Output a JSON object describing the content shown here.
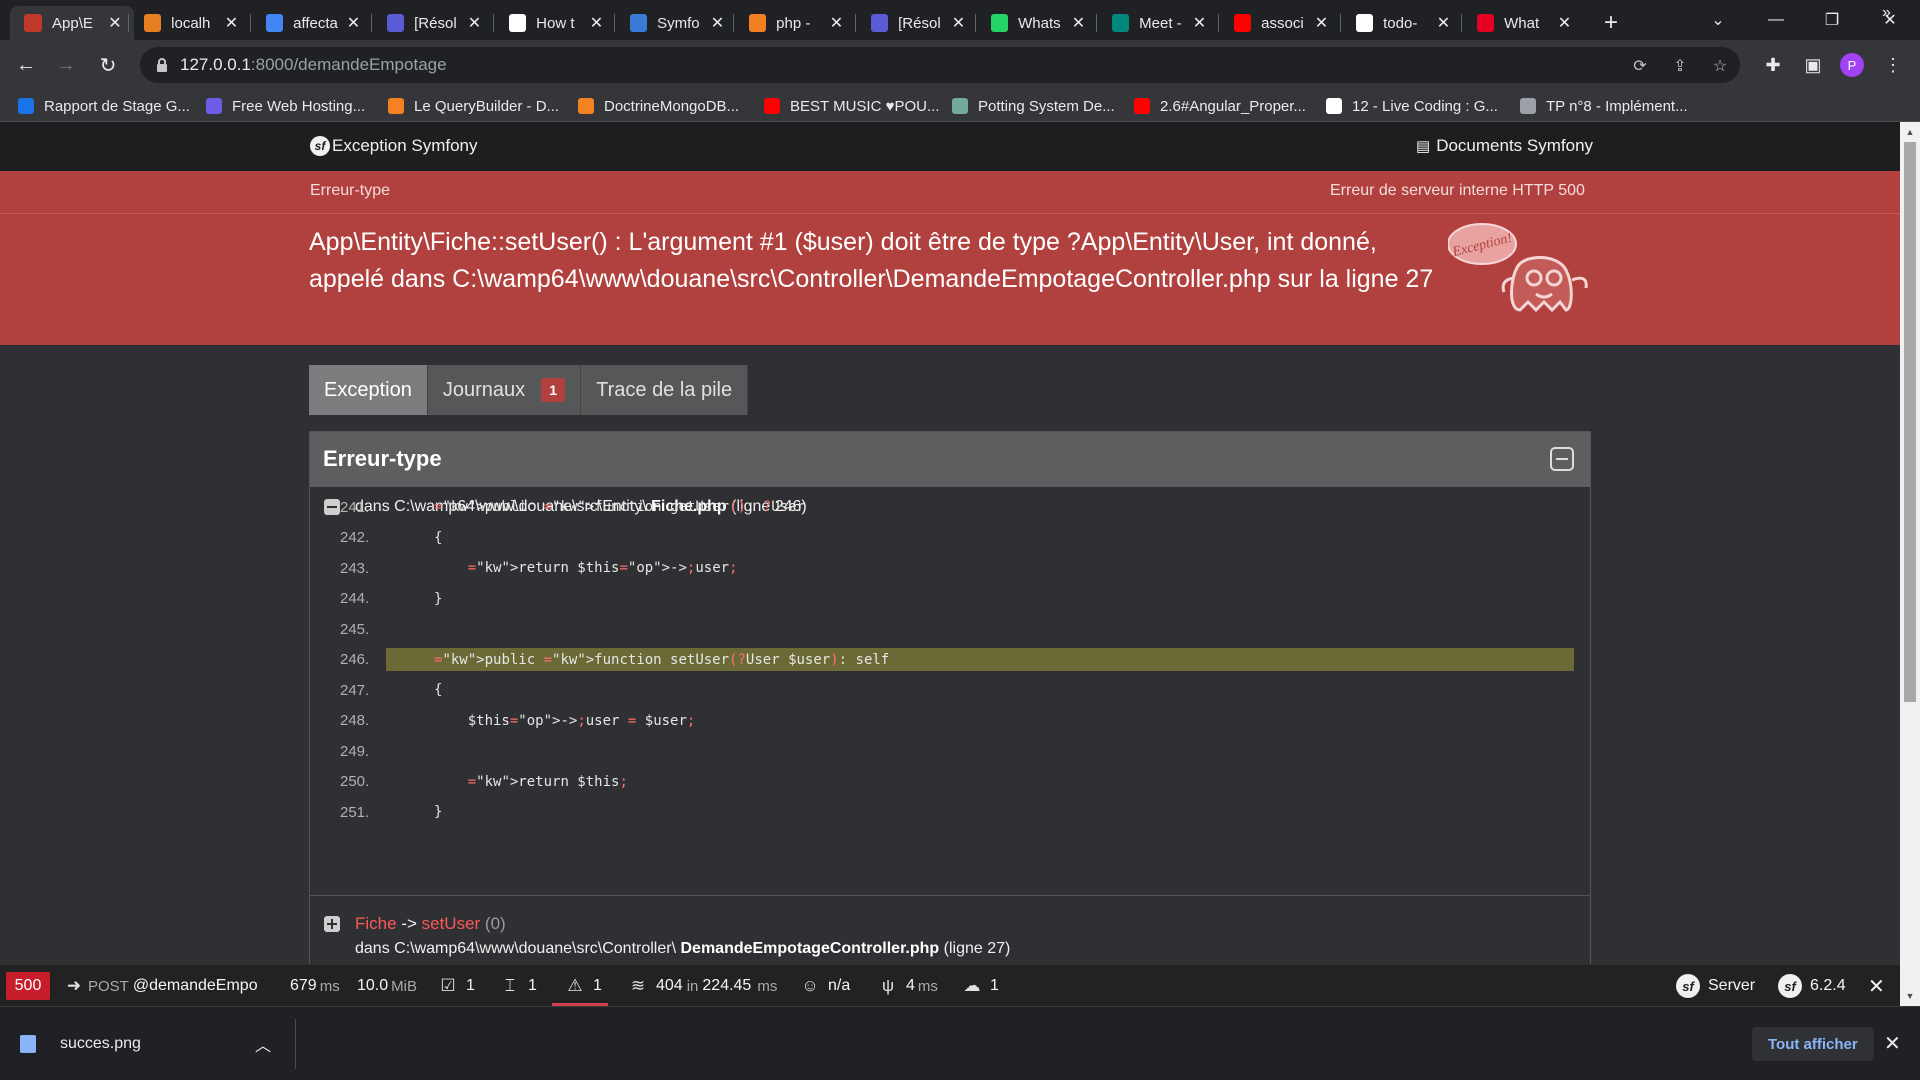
{
  "browser": {
    "tabs": [
      {
        "label": "App\\E",
        "icon": "symfony-ghost-icon",
        "color": "#c0392b"
      },
      {
        "label": "localh",
        "icon": "wamp-icon",
        "color": "#e67e22"
      },
      {
        "label": "affecta",
        "icon": "google-icon",
        "color": "#4285f4"
      },
      {
        "label": "[Résol",
        "icon": "d-icon",
        "color": "#5b5bd6"
      },
      {
        "label": "How t",
        "icon": "symfony-icon",
        "color": "#ffffff"
      },
      {
        "label": "Symfo",
        "icon": "symfonycasts-icon",
        "color": "#3a7bd5"
      },
      {
        "label": "php - ",
        "icon": "stackoverflow-icon",
        "color": "#f48024"
      },
      {
        "label": "[Résol",
        "icon": "d-icon",
        "color": "#5b5bd6"
      },
      {
        "label": "Whats",
        "icon": "whatsapp-icon",
        "color": "#25d366"
      },
      {
        "label": "Meet -",
        "icon": "meet-icon",
        "color": "#00897b"
      },
      {
        "label": "associ",
        "icon": "youtube-icon",
        "color": "#ff0000"
      },
      {
        "label": "todo-",
        "icon": "github-icon",
        "color": "#ffffff"
      },
      {
        "label": "What ",
        "icon": "pinterest-icon",
        "color": "#e60023"
      }
    ],
    "url_host": "127.0.0.1",
    "url_path": ":8000/demandeEmpotage",
    "profile_initial": "P",
    "bookmarks": [
      {
        "label": "Rapport de Stage G...",
        "icon": "s-icon",
        "color": "#1a73e8"
      },
      {
        "label": "Free Web Hosting...",
        "icon": "infinity-icon",
        "color": "#6c5ce7"
      },
      {
        "label": "Le QueryBuilder - D...",
        "icon": "doctrine-icon",
        "color": "#f58220"
      },
      {
        "label": "DoctrineMongoDB...",
        "icon": "doctrine-icon",
        "color": "#f58220"
      },
      {
        "label": "BEST MUSIC ♥POU...",
        "icon": "youtube-icon",
        "color": "#ff0000"
      },
      {
        "label": "Potting System De...",
        "icon": "openai-icon",
        "color": "#74aa9c"
      },
      {
        "label": "2.6#Angular_Proper...",
        "icon": "youtube-icon",
        "color": "#ff0000"
      },
      {
        "label": "12 - Live Coding : G...",
        "icon": "codingame-icon",
        "color": "#ffffff"
      },
      {
        "label": "TP n°8 - Implément...",
        "icon": "globe-icon",
        "color": "#9aa0a6"
      }
    ]
  },
  "symfony": {
    "header_left": "Exception Symfony",
    "header_right": "Documents Symfony",
    "error_type": "Erreur-type",
    "http_status": "Erreur de serveur interne HTTP 500",
    "message": "App\\Entity\\Fiche::setUser() : L'argument #1 ($user) doit être de type ?App\\Entity\\User, int donné, appelé dans C:\\wamp64\\www\\douane\\src\\Controller\\DemandeEmpotageController.php sur la ligne 27",
    "ghost_label": "Exception!",
    "tabs": [
      {
        "label": "Exception",
        "active": true
      },
      {
        "label": "Journaux",
        "badge": "1"
      },
      {
        "label": "Trace de la pile"
      }
    ],
    "panel_title": "Erreur-type",
    "trace1": {
      "prefix": "dans C:\\wamp64\\www\\douane\\src\\Entity\\ ",
      "file": "Fiche.php",
      "suffix": " (ligne 246)"
    },
    "code_lines": [
      {
        "n": "241.",
        "code": "public function getUser(): ?User"
      },
      {
        "n": "242.",
        "code": "{"
      },
      {
        "n": "243.",
        "code": "    return $this->user;"
      },
      {
        "n": "244.",
        "code": "}"
      },
      {
        "n": "245.",
        "code": ""
      },
      {
        "n": "246.",
        "code": "public function setUser(?User $user): self"
      },
      {
        "n": "247.",
        "code": "{"
      },
      {
        "n": "248.",
        "code": "    $this->user = $user;"
      },
      {
        "n": "249.",
        "code": ""
      },
      {
        "n": "250.",
        "code": "    return $this;"
      },
      {
        "n": "251.",
        "code": "}"
      }
    ],
    "highlight_line": "246.",
    "trace2": {
      "class": "Fiche",
      "arrow": " -> ",
      "method": "setUser",
      "args": " (0)",
      "prefix": "dans C:\\wamp64\\www\\douane\\src\\Controller\\ ",
      "file": "DemandeEmpotageController.php",
      "suffix": " (ligne 27)"
    }
  },
  "profiler": {
    "status": "500",
    "method": "POST",
    "route": "@demandeEmpotag",
    "time": "679",
    "time_unit": "ms",
    "memory": "10.0",
    "memory_unit": "MiB",
    "forms": "1",
    "validator": "1",
    "logs": "1",
    "cache": "404",
    "cache_in": "in",
    "cache_time": "224.45",
    "cache_unit": "ms",
    "user": "n/a",
    "twig": "4",
    "twig_unit": "ms",
    "db": "1",
    "server_label": "Server",
    "version": "6.2.4"
  },
  "downloads": {
    "file": "succes.png",
    "show_all": "Tout afficher"
  }
}
